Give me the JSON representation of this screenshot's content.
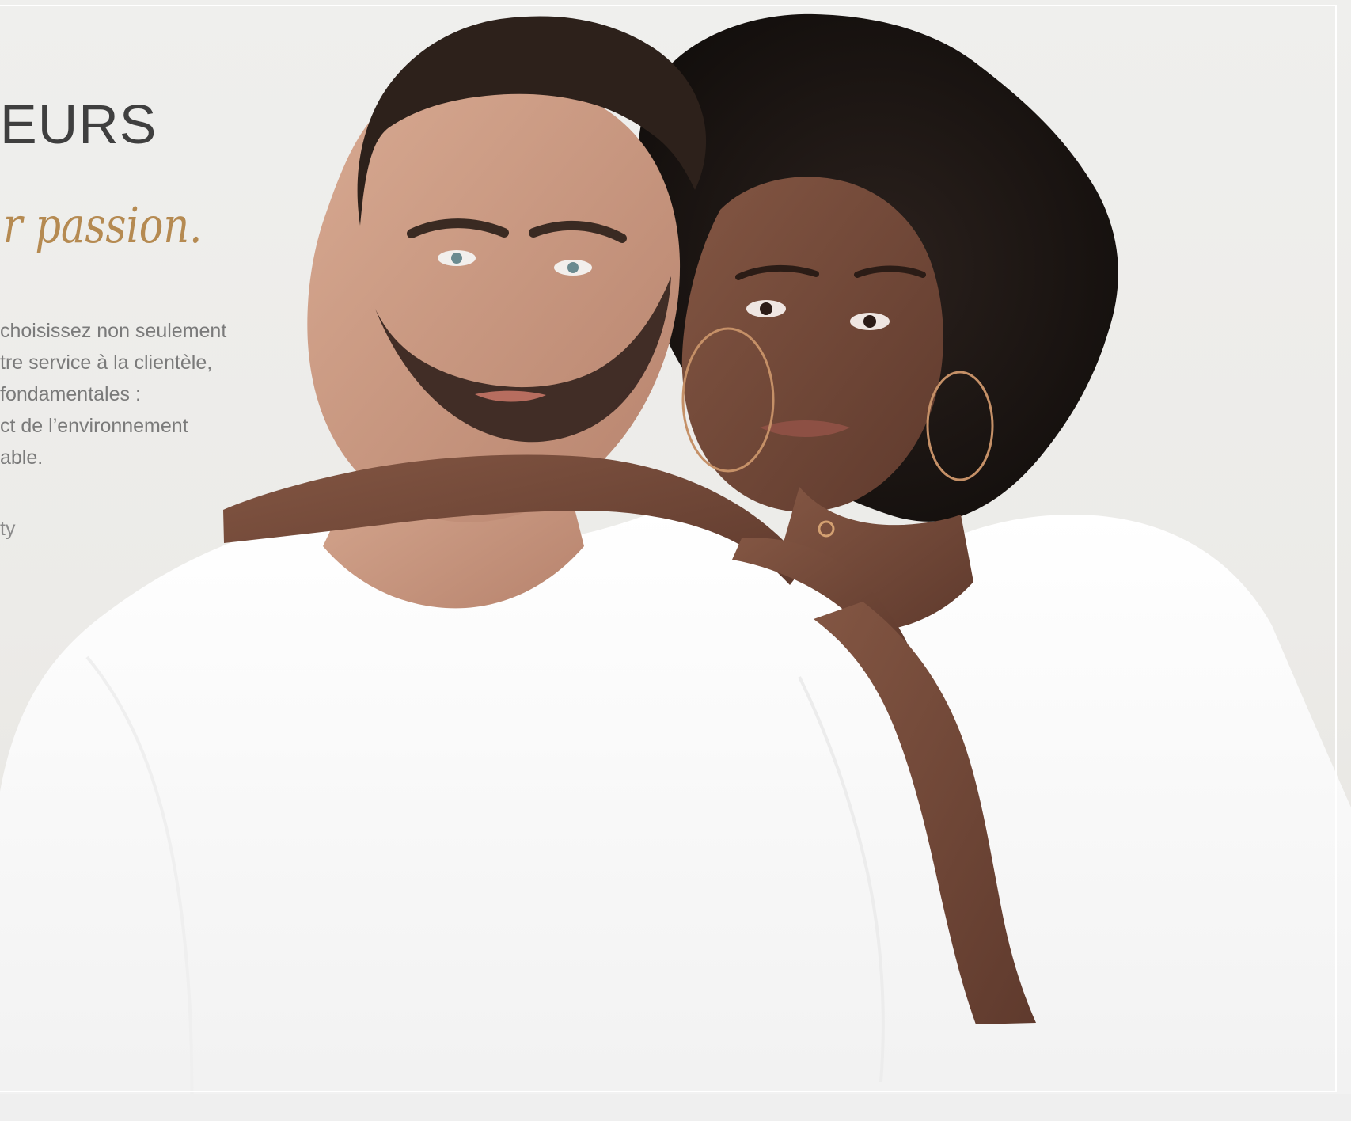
{
  "page": {
    "heading": "EURS",
    "tagline": "r passion.",
    "body_lines": [
      "choisissez non seulement",
      "tre service à la clientèle,",
      " fondamentales :",
      "ct de l’environnement",
      "able."
    ],
    "signature": "ty"
  },
  "colors": {
    "background": "#ecebe8",
    "heading": "#3f3f3f",
    "accent": "#b58a51",
    "body": "#7a7a7a",
    "shirt": "#ffffff",
    "skin_light": "#c99b83",
    "skin_dark": "#6b4635",
    "hair_dark": "#1d1714"
  }
}
